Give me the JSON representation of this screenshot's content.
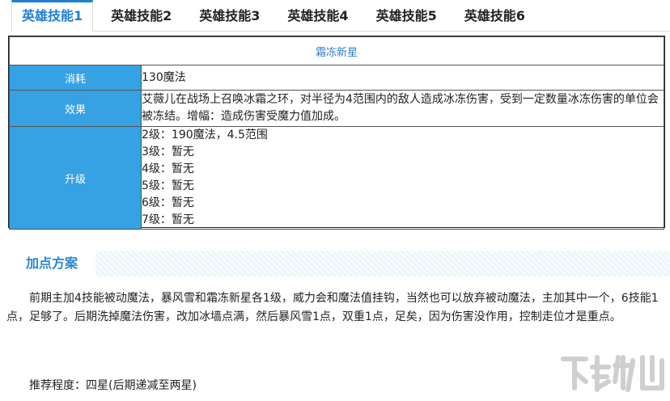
{
  "tabs": [
    {
      "label": "英雄技能1",
      "active": true
    },
    {
      "label": "英雄技能2",
      "active": false
    },
    {
      "label": "英雄技能3",
      "active": false
    },
    {
      "label": "英雄技能4",
      "active": false
    },
    {
      "label": "英雄技能5",
      "active": false
    },
    {
      "label": "英雄技能6",
      "active": false
    }
  ],
  "skill": {
    "name": "霜冻新星",
    "cost_label": "消耗",
    "cost_value": "130魔法",
    "effect_label": "效果",
    "effect_value": "艾薇儿在战场上召唤冰霜之环，对半径为4范围内的敌人造成冰冻伤害，受到一定数量冰冻伤害的单位会被冻结。增幅：造成伤害受魔力值加成。",
    "upgrade_label": "升级",
    "upgrades": [
      "2级：190魔法，4.5范围",
      "3级：暂无",
      "4级：暂无",
      "5级：暂无",
      "6级：暂无",
      "7级：暂无"
    ]
  },
  "section": {
    "title": "加点方案",
    "paragraph": "前期主加4技能被动魔法，暴风雪和霜冻新星各1级，威力会和魔法值挂钩，当然也可以放弃被动魔法，主加其中一个，6技能1点，足够了。后期洗掉魔法伤害，改加冰墙点满，然后暴风雪1点，双重1点，足矣，因为伤害没作用，控制走位才是重点。",
    "recommendation": "推荐程度：四星(后期递减至两星)"
  },
  "colors": {
    "accent": "#1f7ed6",
    "label_bg": "#36a1e3",
    "title_text": "#2f7dc8"
  },
  "watermark": {
    "icon": "xiazaiba-logo"
  }
}
